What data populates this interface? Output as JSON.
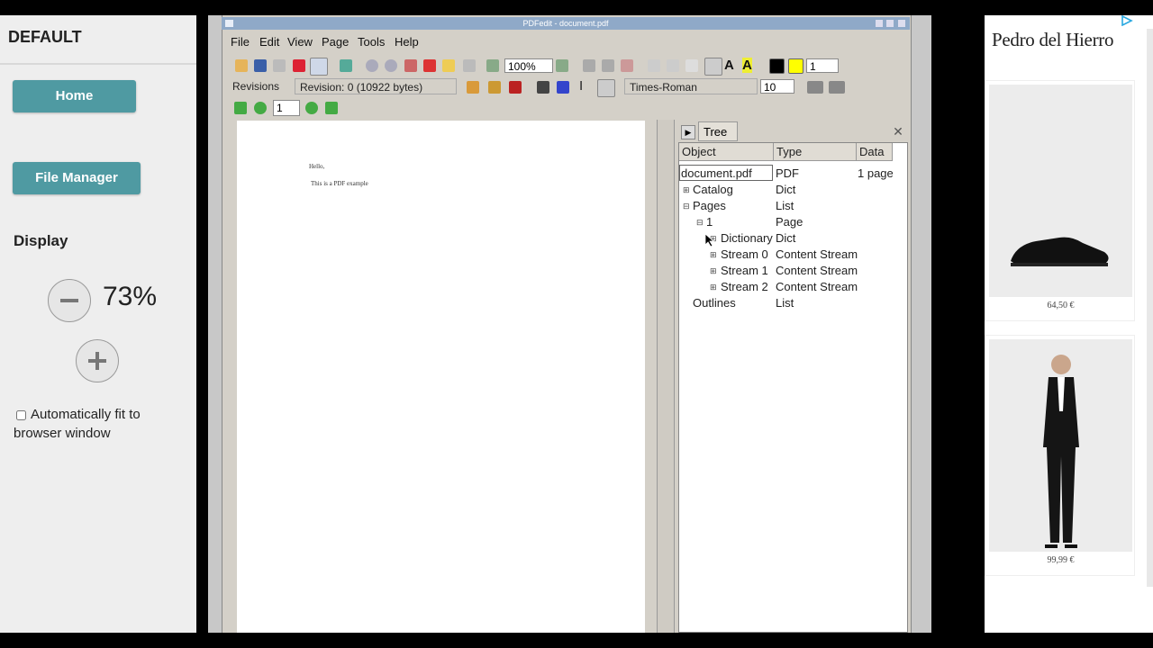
{
  "left_panel": {
    "brand": "DEFAULT",
    "home_label": "Home",
    "file_manager_label": "File Manager",
    "display_heading": "Display",
    "zoom_percent": "73%",
    "auto_fit_label": "Automatically fit to browser window",
    "auto_fit_checked": false
  },
  "app": {
    "title": "PDFedit - document.pdf",
    "menu": [
      "File",
      "Edit",
      "View",
      "Page",
      "Tools",
      "Help"
    ],
    "zoom_value": "100%",
    "color_width_value": "1",
    "revisions_label": "Revisions",
    "revision_combo": "Revision: 0 (10922 bytes)",
    "font_combo": "Times-Roman",
    "font_size": "10",
    "page_number": "1",
    "page_text_line1": "Hello,",
    "page_text_line2": "This is a PDF example",
    "tree_tab_label": "Tree",
    "tree_columns": [
      "Object",
      "Type",
      "Data"
    ],
    "tree_rows": [
      {
        "object": "document.pdf",
        "type": "PDF",
        "data": "1 page"
      },
      {
        "object": "Catalog",
        "type": "Dict",
        "data": ""
      },
      {
        "object": "Pages",
        "type": "List",
        "data": ""
      },
      {
        "object": "1",
        "type": "Page",
        "data": ""
      },
      {
        "object": "Dictionary",
        "type": "Dict",
        "data": ""
      },
      {
        "object": "Stream 0",
        "type": "Content Stream",
        "data": ""
      },
      {
        "object": "Stream 1",
        "type": "Content Stream",
        "data": ""
      },
      {
        "object": "Stream 2",
        "type": "Content Stream",
        "data": ""
      },
      {
        "object": "Outlines",
        "type": "List",
        "data": ""
      }
    ]
  },
  "ad": {
    "brand": "Pedro del Hierro",
    "price_1": "64,50 €",
    "price_2": "99,99 €"
  },
  "colors": {
    "teal": "#4f9aa2",
    "titlebar": "#8fa9c8",
    "ad_choices": "#29a8e0"
  }
}
